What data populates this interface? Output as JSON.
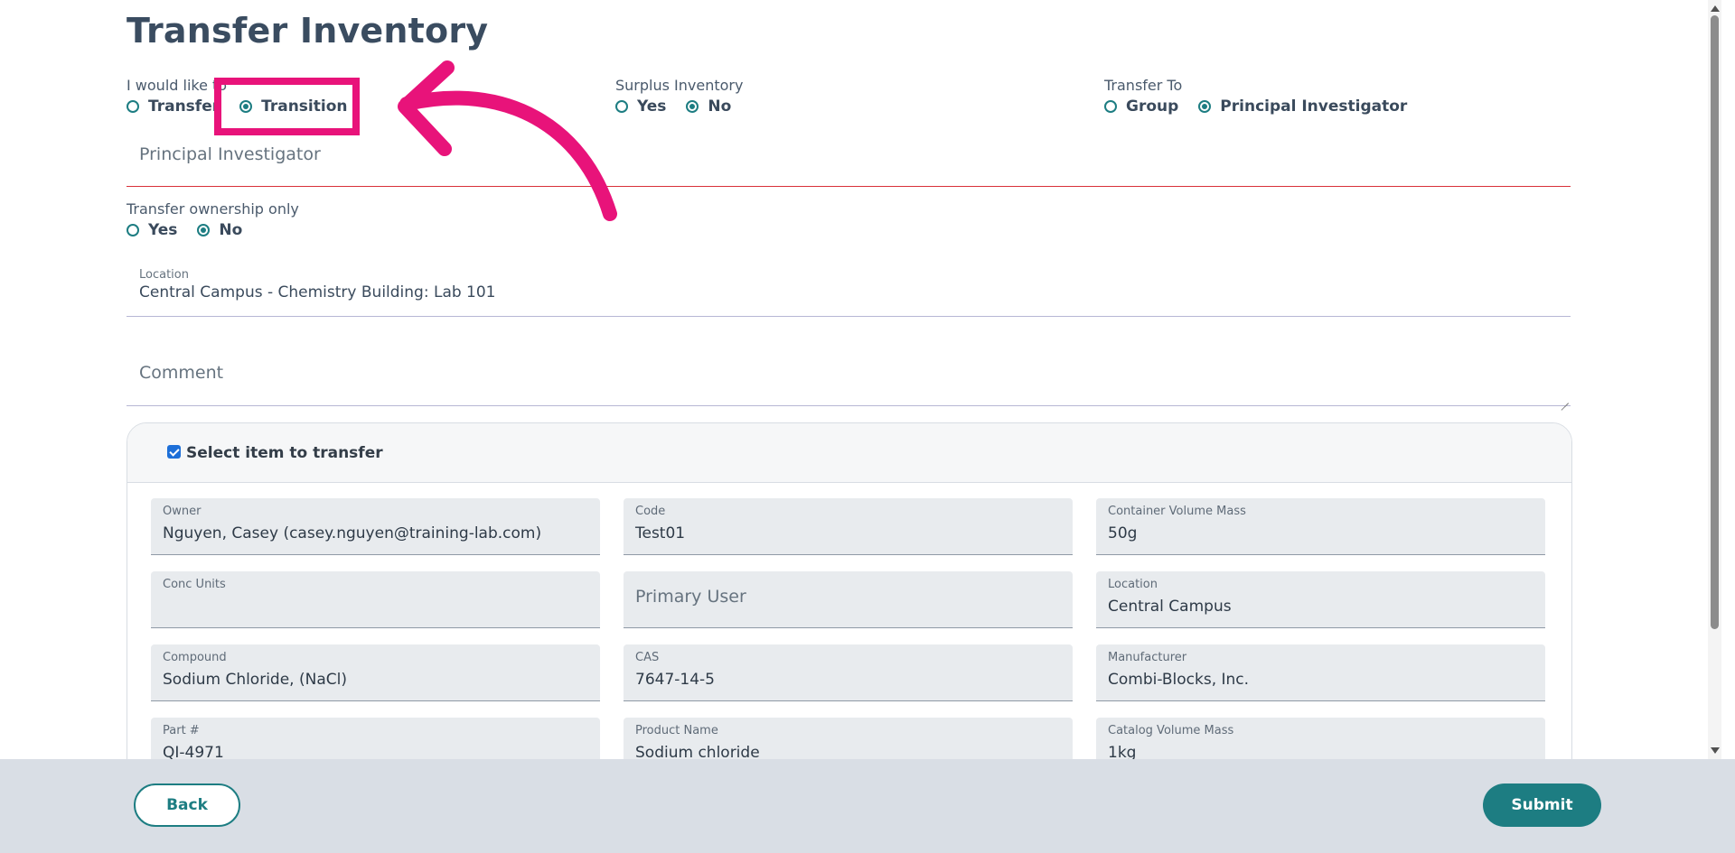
{
  "page": {
    "title": "Transfer Inventory"
  },
  "action": {
    "label": "I would like to",
    "options": [
      {
        "label": "Transfer",
        "selected": false
      },
      {
        "label": "Transition",
        "selected": true
      }
    ]
  },
  "surplus": {
    "label": "Surplus Inventory",
    "options": [
      {
        "label": "Yes",
        "selected": false
      },
      {
        "label": "No",
        "selected": true
      }
    ]
  },
  "transfer_to": {
    "label": "Transfer To",
    "options": [
      {
        "label": "Group",
        "selected": false
      },
      {
        "label": "Principal Investigator",
        "selected": true
      }
    ]
  },
  "principal_investigator": {
    "placeholder": "Principal Investigator"
  },
  "ownership_only": {
    "label": "Transfer ownership only",
    "options": [
      {
        "label": "Yes",
        "selected": false
      },
      {
        "label": "No",
        "selected": true
      }
    ]
  },
  "location": {
    "label": "Location",
    "value": "Central Campus - Chemistry Building: Lab 101"
  },
  "comment": {
    "placeholder": "Comment"
  },
  "item_card": {
    "select_label": "Select item to transfer",
    "checked": true,
    "fields": [
      {
        "label": "Owner",
        "value": "Nguyen, Casey (casey.nguyen@training-lab.com)"
      },
      {
        "label": "Code",
        "value": "Test01"
      },
      {
        "label": "Container Volume Mass",
        "value": "50g"
      },
      {
        "label": "Conc Units",
        "value": ""
      },
      {
        "placeholder": "Primary User"
      },
      {
        "label": "Location",
        "value": "Central Campus"
      },
      {
        "label": "Compound",
        "value": "Sodium Chloride, (NaCl)"
      },
      {
        "label": "CAS",
        "value": "7647-14-5"
      },
      {
        "label": "Manufacturer",
        "value": "Combi-Blocks, Inc."
      },
      {
        "label": "Part #",
        "value": "QI-4971"
      },
      {
        "label": "Product Name",
        "value": "Sodium chloride"
      },
      {
        "label": "Catalog Volume Mass",
        "value": "1kg"
      }
    ]
  },
  "footer": {
    "back_label": "Back",
    "submit_label": "Submit"
  },
  "annotation": {
    "color": "#e8137a"
  },
  "colors": {
    "accent": "#1d7d82",
    "error_line": "#d9303a"
  }
}
